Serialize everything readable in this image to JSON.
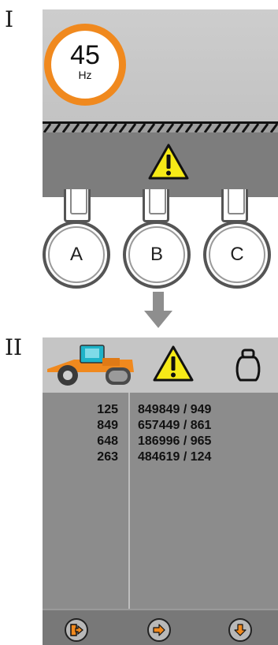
{
  "section_one": {
    "label": "I",
    "frequency": {
      "value": "45",
      "unit": "Hz"
    },
    "supports": [
      {
        "label": "A"
      },
      {
        "label": "B"
      },
      {
        "label": "C"
      }
    ]
  },
  "section_two": {
    "label": "II",
    "rows": [
      {
        "left": "125",
        "right": "849849 / 949"
      },
      {
        "left": "849",
        "right": "657449 / 861"
      },
      {
        "left": "648",
        "right": "186996 / 965"
      },
      {
        "left": "263",
        "right": "484619 / 124"
      }
    ],
    "footer_icons": [
      "exit-icon",
      "arrow-right-icon",
      "arrow-down-icon"
    ]
  },
  "colors": {
    "accent_orange": "#f0891e",
    "warning_yellow": "#f6ea17",
    "roller_teal": "#1fb3c8",
    "panel_light": "#c5c5c5",
    "panel_dark": "#8a8a8a"
  }
}
